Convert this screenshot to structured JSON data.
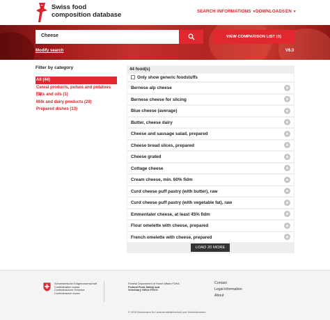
{
  "header": {
    "logo_line1": "Swiss food",
    "logo_line2": "composition database",
    "nav": {
      "search": "SEARCH",
      "informations": "INFORMATIONS",
      "downloads": "DOWNLOADS",
      "language": "EN"
    }
  },
  "search": {
    "value": "Cheese",
    "compare_label": "VIEW COMPARISON LIST (0)",
    "modify_label": "Modify search",
    "version": "V6.0"
  },
  "filter": {
    "title": "Filter by category",
    "categories": [
      {
        "label": "All (44)"
      },
      {
        "label": "Cereal products, pulses and potatoes (3)"
      },
      {
        "label": "Fats and oils (1)"
      },
      {
        "label": "Milk and dairy products (28)"
      },
      {
        "label": "Prepared dishes (13)"
      }
    ]
  },
  "results": {
    "count": "44 food(s)",
    "generic_label": "Only show generic foodstuffs",
    "foods": [
      "Bernese alp cheese",
      "Bernese cheese for slicing",
      "Blue cheese (average)",
      "Butter, cheese dairy",
      "Cheese and sausage salad, prepared",
      "Cheese bread slices, prepared",
      "Cheese grated",
      "Cottage cheese",
      "Cream cheese, min. 60% fidm",
      "Curd cheese puff pastry (with butter), raw",
      "Curd cheese puff pastry (with vegetable fat), raw",
      "Emmentaler cheese, at least 45% fidm",
      "Flour omelette with cheese, prepared",
      "French omelette with cheese, prepared"
    ],
    "load_more": "LOAD 20 MORE"
  },
  "footer": {
    "confed_lines": [
      "Schweizerische Eidgenossenschaft",
      "Confédération suisse",
      "Confederazione Svizzera",
      "Confederaziun svizra"
    ],
    "fdha_line1": "Federal Department of Home Affairs FDHA",
    "fdha_line2": "Federal Food Safety and",
    "fdha_line3": "Veterinary Office FSVO",
    "links": {
      "contact": "Contact",
      "legal": "Legal information",
      "about": "About"
    },
    "copyright": "© 2019 Bundesamt für Lebensmittelsicherheit und Veterinärwesen."
  },
  "colors": {
    "accent": "#e0282e",
    "link_red": "#d8232a"
  }
}
